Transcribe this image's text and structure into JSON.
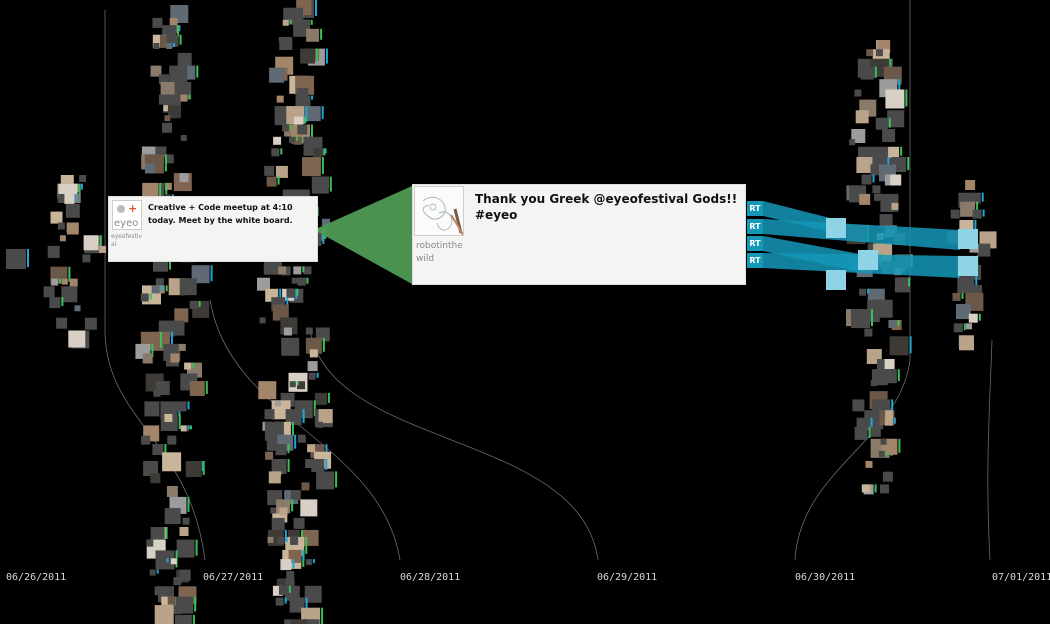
{
  "timeline": {
    "dates": [
      "06/26/2011",
      "06/27/2011",
      "06/28/2011",
      "06/29/2011",
      "06/30/2011",
      "07/01/2011"
    ]
  },
  "tweets": {
    "small": {
      "handle": "eyeofestival",
      "text": "Creative + Code meetup at 4:10 today. Meet by the white board.",
      "logo_text": "eyeo"
    },
    "large": {
      "handle": "robotinthewild",
      "text": "Thank you Greek @eyeofestival Gods!! #eyeo",
      "retweets": [
        "RT",
        "RT",
        "RT",
        "RT"
      ]
    }
  },
  "colors": {
    "background": "#000000",
    "tile": "#4a4a4a",
    "retweet": "#1598b8",
    "highlight": "#4f9a55",
    "accent_green": "#3cbf5a",
    "accent_blue": "#22a6d6"
  }
}
